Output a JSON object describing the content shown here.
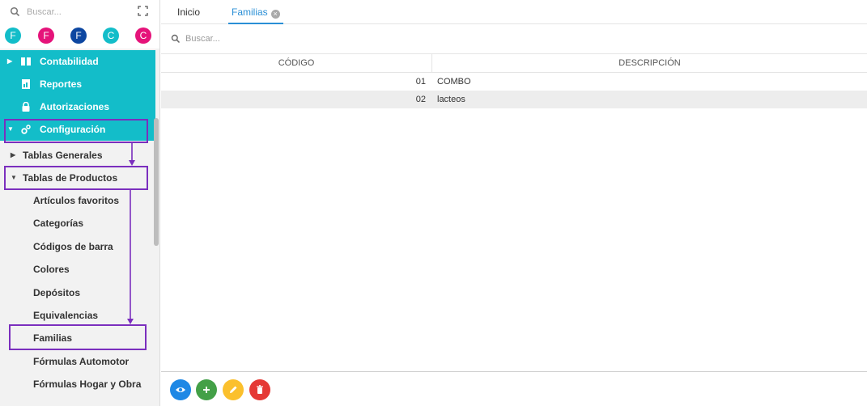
{
  "sidebar": {
    "search_placeholder": "Buscar...",
    "avatars": [
      {
        "letter": "F",
        "color": "#13bdc9"
      },
      {
        "letter": "F",
        "color": "#e5137a"
      },
      {
        "letter": "F",
        "color": "#0d47a1"
      },
      {
        "letter": "C",
        "color": "#13bdc9"
      },
      {
        "letter": "C",
        "color": "#e5137a"
      }
    ],
    "menu": {
      "contabilidad": "Contabilidad",
      "reportes": "Reportes",
      "autorizaciones": "Autorizaciones",
      "configuracion": "Configuración"
    },
    "submenu": {
      "tablas_generales": "Tablas Generales",
      "tablas_productos": "Tablas de Productos"
    },
    "items": [
      "Artículos favoritos",
      "Categorías",
      "Códigos de barra",
      "Colores",
      "Depósitos",
      "Equivalencias",
      "Familias",
      "Fórmulas Automotor",
      "Fórmulas Hogar y Obra"
    ]
  },
  "tabs": {
    "inicio": "Inicio",
    "familias": "Familias"
  },
  "main": {
    "search_placeholder": "Buscar...",
    "columns": [
      "CÓDIGO",
      "DESCRIPCIÓN"
    ],
    "rows": [
      {
        "codigo": "01",
        "descripcion": "COMBO"
      },
      {
        "codigo": "02",
        "descripcion": "lacteos"
      }
    ]
  },
  "actions": [
    {
      "icon": "eye-icon",
      "color": "#1e88e5"
    },
    {
      "icon": "plus-icon",
      "color": "#43a047"
    },
    {
      "icon": "pencil-icon",
      "color": "#fbc02d"
    },
    {
      "icon": "trash-icon",
      "color": "#e53935"
    }
  ],
  "colors": {
    "accent_teal": "#13bdc9",
    "tab_active": "#2a8fd6",
    "annotation": "#7b2fbe"
  }
}
